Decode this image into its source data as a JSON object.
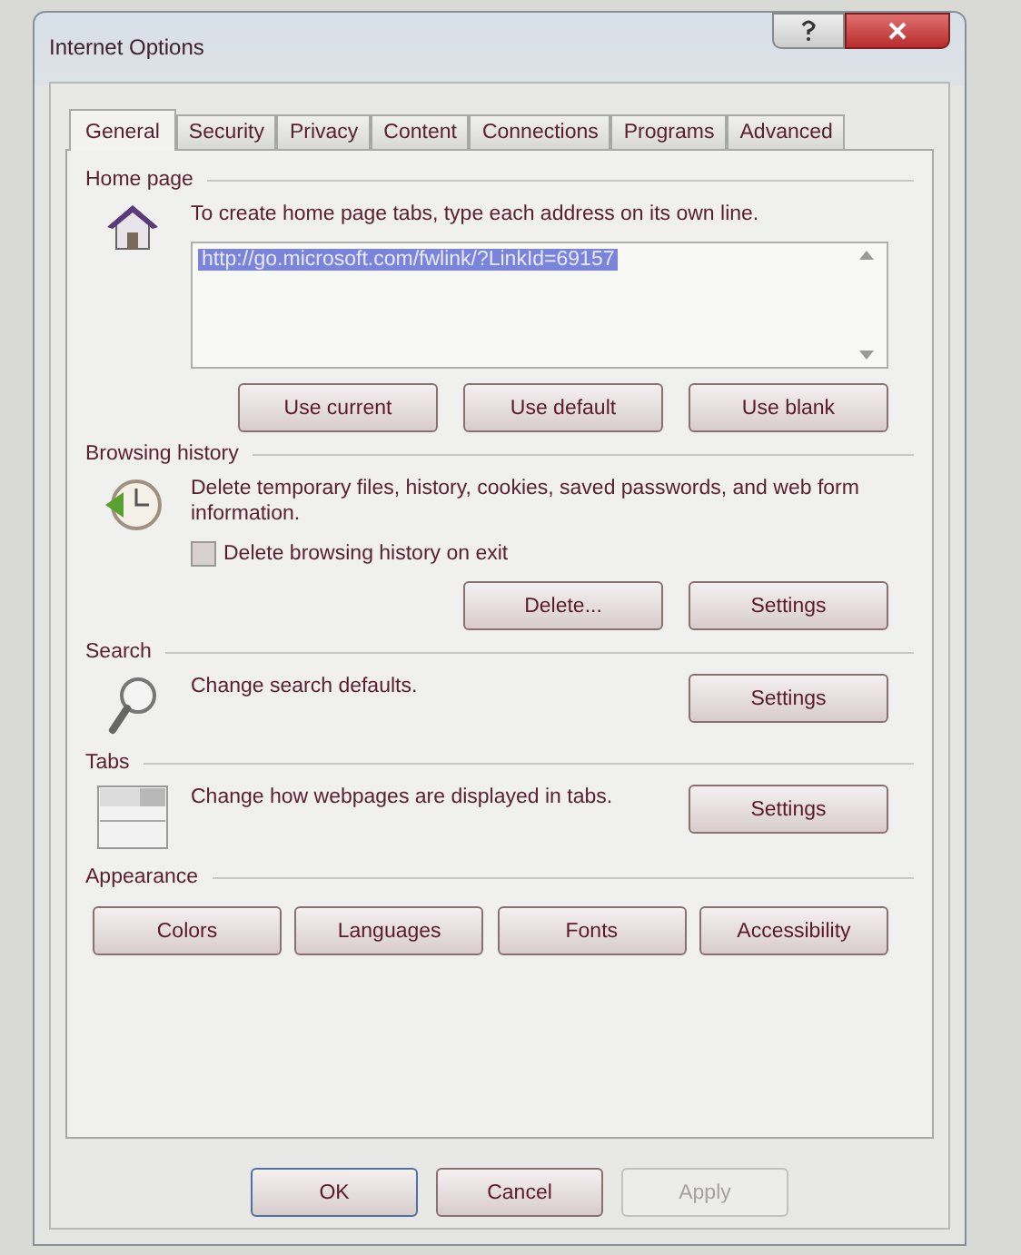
{
  "window": {
    "title": "Internet Options"
  },
  "tabs": [
    {
      "label": "General",
      "selected": true
    },
    {
      "label": "Security",
      "selected": false
    },
    {
      "label": "Privacy",
      "selected": false
    },
    {
      "label": "Content",
      "selected": false
    },
    {
      "label": "Connections",
      "selected": false
    },
    {
      "label": "Programs",
      "selected": false
    },
    {
      "label": "Advanced",
      "selected": false
    }
  ],
  "sections": [
    {
      "kind": "home",
      "heading": "Home page",
      "description": "To create home page tabs, type each address on its own line.",
      "address": "http://go.microsoft.com/fwlink/?LinkId=69157",
      "buttons": [
        {
          "label": "Use current"
        },
        {
          "label": "Use default"
        },
        {
          "label": "Use blank"
        }
      ]
    },
    {
      "kind": "history",
      "heading": "Browsing history",
      "description": "Delete temporary files, history, cookies, saved passwords, and web form information.",
      "checkbox": {
        "label": "Delete browsing history on exit",
        "checked": false
      },
      "buttons": [
        {
          "label": "Delete..."
        },
        {
          "label": "Settings"
        }
      ]
    },
    {
      "kind": "search",
      "heading": "Search",
      "description": "Change search defaults.",
      "buttons": [
        {
          "label": "Settings"
        }
      ]
    },
    {
      "kind": "tabs",
      "heading": "Tabs",
      "description": "Change how webpages are displayed in tabs.",
      "buttons": [
        {
          "label": "Settings"
        }
      ]
    },
    {
      "kind": "appearance",
      "heading": "Appearance",
      "buttons": [
        {
          "label": "Colors"
        },
        {
          "label": "Languages"
        },
        {
          "label": "Fonts"
        },
        {
          "label": "Accessibility"
        }
      ]
    }
  ],
  "footer_buttons": [
    {
      "label": "OK",
      "disabled": false
    },
    {
      "label": "Cancel",
      "disabled": false
    },
    {
      "label": "Apply",
      "disabled": true
    }
  ]
}
